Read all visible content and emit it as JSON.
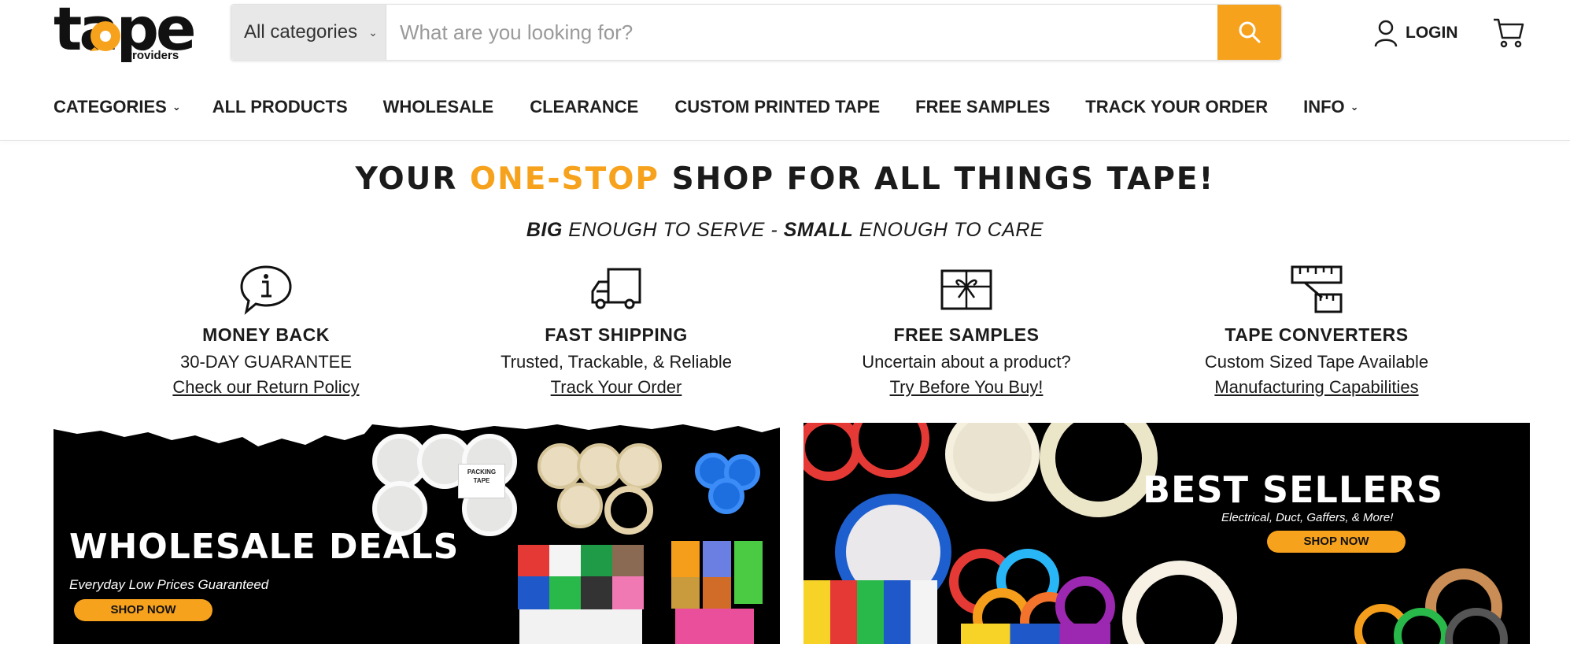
{
  "logo": {
    "word": "tape",
    "sub": "Providers"
  },
  "search": {
    "category_label": "All categories",
    "placeholder": "What are you looking for?"
  },
  "header": {
    "login_label": "LOGIN"
  },
  "nav": {
    "items": [
      {
        "label": "CATEGORIES",
        "dropdown": true
      },
      {
        "label": "ALL PRODUCTS"
      },
      {
        "label": "WHOLESALE"
      },
      {
        "label": "CLEARANCE"
      },
      {
        "label": "CUSTOM PRINTED TAPE"
      },
      {
        "label": "FREE SAMPLES"
      },
      {
        "label": "TRACK YOUR ORDER"
      },
      {
        "label": "INFO",
        "dropdown": true
      }
    ]
  },
  "headline": {
    "part1": "YOUR ",
    "accent": "ONE-STOP",
    "part2": " SHOP FOR ALL THINGS TAPE!"
  },
  "tagline": {
    "big": "BIG",
    "mid": " ENOUGH TO SERVE - ",
    "small": "SMALL",
    "end": " ENOUGH TO CARE"
  },
  "features": [
    {
      "icon": "info-chat-icon",
      "title": "MONEY BACK",
      "desc": "30-DAY GUARANTEE",
      "link": "Check our Return Policy"
    },
    {
      "icon": "truck-icon",
      "title": "FAST SHIPPING",
      "desc": "Trusted, Trackable, & Reliable",
      "link": "Track Your Order"
    },
    {
      "icon": "gift-icon",
      "title": "FREE SAMPLES",
      "desc": "Uncertain about a product?",
      "link": "Try Before You Buy!"
    },
    {
      "icon": "ruler-icon",
      "title": "TAPE CONVERTERS",
      "desc": "Custom Sized Tape Available",
      "link": "Manufacturing Capabilities"
    }
  ],
  "banners": {
    "wholesale": {
      "title": "WHOLESALE DEALS",
      "subtitle": "Everyday Low Prices Guaranteed",
      "button": "SHOP NOW",
      "box_label": "PACKING TAPE"
    },
    "best_sellers": {
      "title": "BEST SELLERS",
      "subtitle": "Electrical, Duct, Gaffers, & More!",
      "button": "SHOP NOW"
    }
  },
  "colors": {
    "accent": "#f7a21d",
    "text": "#1b1b1b",
    "banner_bg": "#000000"
  }
}
